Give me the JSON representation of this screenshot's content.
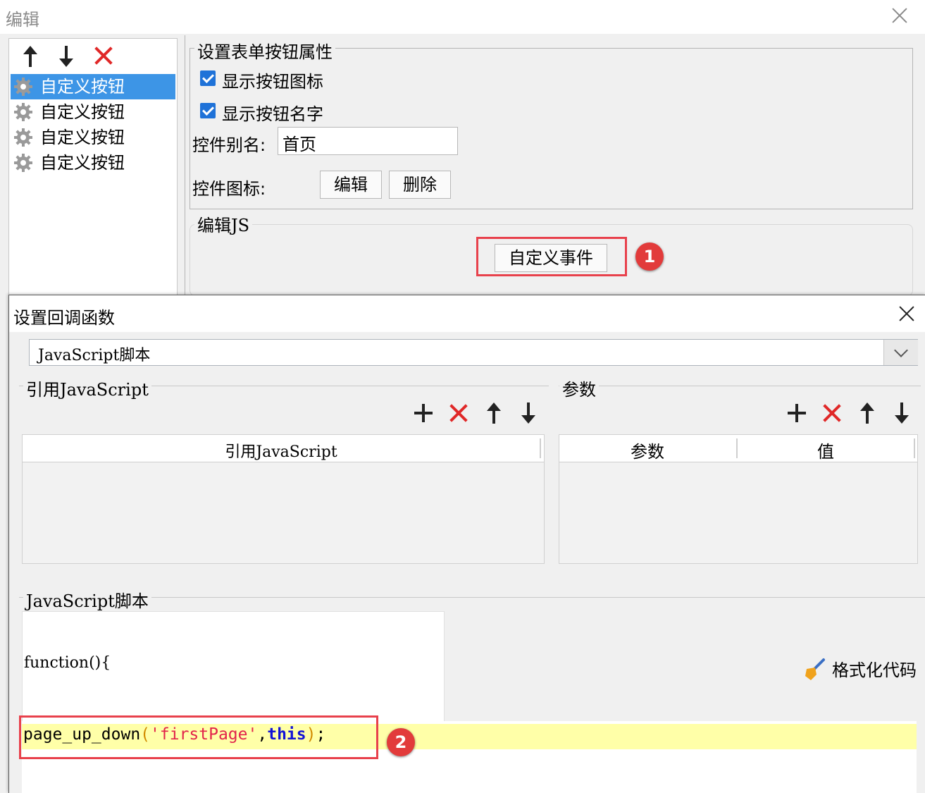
{
  "outer": {
    "title": "编辑",
    "toolbar": {
      "up_icon": "arrow-up-icon",
      "down_icon": "arrow-down-icon",
      "delete_icon": "delete-x-icon"
    },
    "list_items": [
      "自定义按钮",
      "自定义按钮",
      "自定义按钮",
      "自定义按钮"
    ],
    "selected_index": 0,
    "props_group": {
      "title": "设置表单按钮属性",
      "show_icon_label": "显示按钮图标",
      "show_icon_checked": true,
      "show_name_label": "显示按钮名字",
      "show_name_checked": true,
      "alias_label": "控件别名:",
      "alias_value": "首页",
      "icon_label": "控件图标:",
      "edit_button": "编辑",
      "delete_button": "删除"
    },
    "js_group": {
      "title": "编辑JS",
      "custom_event_button": "自定义事件",
      "badge": "1"
    }
  },
  "inner": {
    "title": "设置回调函数",
    "script_type_selected": "JavaScript脚本",
    "ref_group": {
      "title": "引用JavaScript",
      "column": "引用JavaScript"
    },
    "params_group": {
      "title": "参数",
      "columns": [
        "参数",
        "值"
      ]
    },
    "script_group": {
      "title": "JavaScript脚本",
      "line1": "function(){",
      "line2": {
        "fn": "page_up_down",
        "open": "(",
        "arg": "'firstPage'",
        "comma": ",",
        "this_kw": "this",
        "close": ")",
        "semi": ";"
      },
      "badge": "2",
      "format_button": "格式化代码"
    }
  },
  "colors": {
    "selection": "#3d95e6",
    "highlight_line": "#ffffa8",
    "annotation_red": "#e8414c",
    "keyword_blue": "#1212d6",
    "string_red": "#e2234b"
  }
}
